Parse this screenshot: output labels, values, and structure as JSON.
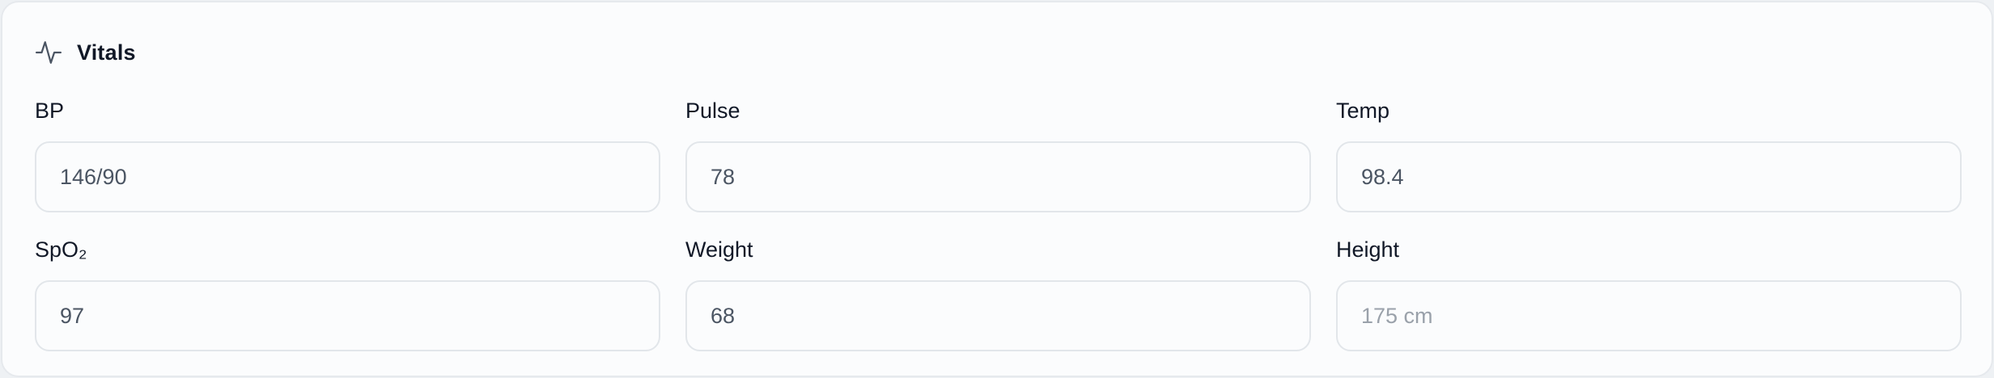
{
  "section": {
    "icon": "activity-pulse-icon",
    "title": "Vitals"
  },
  "fields": [
    {
      "label": "BP",
      "value": "146/90",
      "placeholder": ""
    },
    {
      "label": "Pulse",
      "value": "78",
      "placeholder": ""
    },
    {
      "label": "Temp",
      "value": "98.4",
      "placeholder": ""
    },
    {
      "label": "SpO₂",
      "value": "97",
      "placeholder": ""
    },
    {
      "label": "Weight",
      "value": "68",
      "placeholder": ""
    },
    {
      "label": "Height",
      "value": "",
      "placeholder": "175 cm"
    }
  ],
  "colors": {
    "text": "#111827",
    "value": "#4b5563",
    "placeholder": "#9aa1aa",
    "border": "#e2e6ea",
    "card_bg": "#fbfcfd"
  }
}
